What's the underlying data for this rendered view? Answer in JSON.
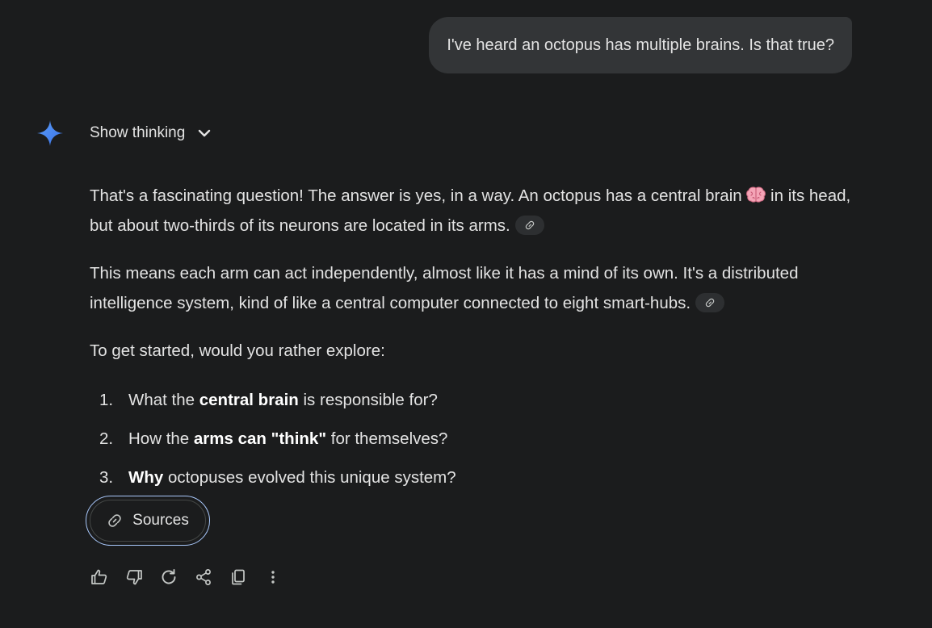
{
  "user_message": "I've heard an octopus has multiple brains. Is that true?",
  "thinking": {
    "label": "Show thinking"
  },
  "response": {
    "p1_before_emoji": "That's a fascinating question! The answer is yes, in a way. An octopus has a central brain ",
    "p1_emoji": "brain-emoji",
    "p1_after_emoji": " in its head, but about two-thirds of its neurons are located in its arms.",
    "p2": "This means each arm can act independently, almost like it has a mind of its own. It's a distributed intelligence system, kind of like a central computer connected to eight smart-hubs.",
    "p3": "To get started, would you rather explore:",
    "options": [
      {
        "num": "1.",
        "before": "What the ",
        "bold": "central brain",
        "after": " is responsible for?"
      },
      {
        "num": "2.",
        "before": "How the ",
        "bold": "arms can \"think\"",
        "after": " for themselves?"
      },
      {
        "num": "3.",
        "before": "",
        "bold": "Why",
        "after": " octopuses evolved this unique system?"
      }
    ]
  },
  "sources": {
    "label": "Sources"
  },
  "actions": [
    "thumbs-up-icon",
    "thumbs-down-icon",
    "regenerate-icon",
    "share-icon",
    "copy-icon",
    "more-options-icon"
  ],
  "colors": {
    "background": "#1b1c1d",
    "bubble": "#333537",
    "text": "#e3e3e3",
    "focus_ring": "#a8c7fa",
    "gemini_blue": "#4a8af4"
  }
}
